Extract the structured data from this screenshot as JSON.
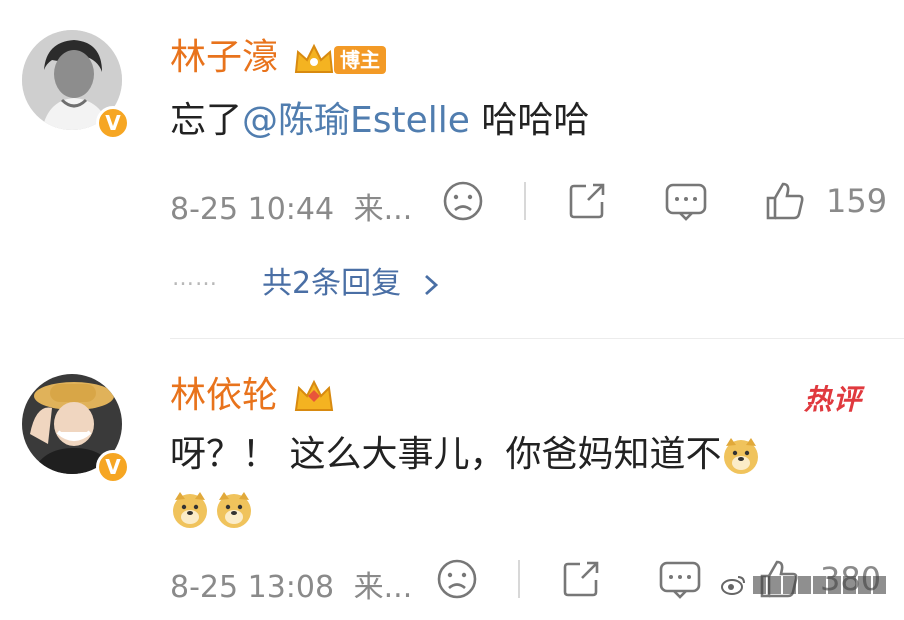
{
  "comments": [
    {
      "username": "林子濠",
      "badge": "博主",
      "text_prefix": "忘了",
      "mention": "@陈瑜Estelle",
      "text_suffix": " 哈哈哈",
      "timestamp": "8-25 10:44",
      "source": "来...",
      "likes": "159",
      "replies_label": "共2条回复",
      "replies_dots": "……",
      "verified_mark": "V"
    },
    {
      "username": "林依轮",
      "hot_label": "热评",
      "text_line1": "呀？！ 这么大事儿，你爸妈知道不",
      "timestamp": "8-25 13:08",
      "source": "来...",
      "likes": "380",
      "verified_mark": "V"
    }
  ],
  "icons": {
    "emotion": "sad-face-icon",
    "share": "share-icon",
    "comment": "comment-icon",
    "like": "thumbs-up-icon",
    "chevron": "chevron-right-icon",
    "emoji": "doge-emoji"
  },
  "colors": {
    "username": "#e8731c",
    "mention": "#507daf",
    "meta": "#8a8a8a",
    "replies": "#4a6fa5",
    "hot": "#e0393e",
    "verified": "#f6a623"
  }
}
